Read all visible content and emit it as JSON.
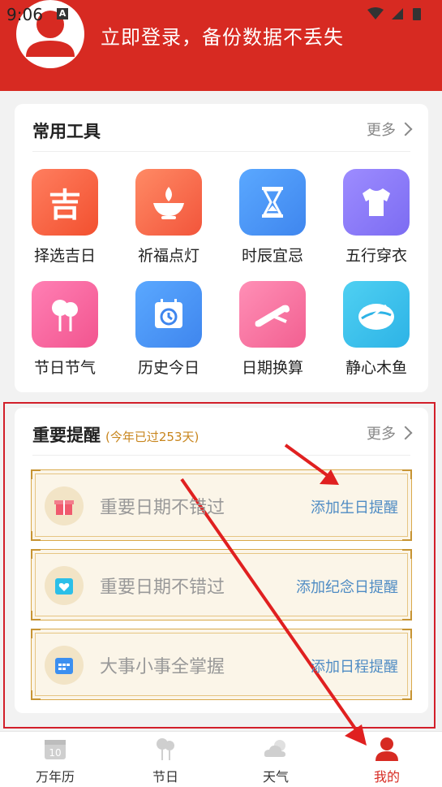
{
  "status_bar": {
    "time": "9:06",
    "indicator": "A"
  },
  "header": {
    "login_text": "立即登录，备份数据不丢失"
  },
  "tools_card": {
    "title": "常用工具",
    "more": "更多",
    "items": [
      {
        "label": "择选吉日",
        "glyph": "吉",
        "icon": "auspicious-day-icon",
        "color_from": "#ff7e5f",
        "color_to": "#f2502f"
      },
      {
        "label": "祈福点灯",
        "icon": "lamp-icon",
        "color_from": "#ff8a65",
        "color_to": "#f2553b"
      },
      {
        "label": "时辰宜忌",
        "icon": "hourglass-icon",
        "color_from": "#5aa8ff",
        "color_to": "#3f86ee"
      },
      {
        "label": "五行穿衣",
        "icon": "shirt-icon",
        "color_from": "#9d8cff",
        "color_to": "#7c6cf2"
      },
      {
        "label": "节日节气",
        "icon": "balloon-icon",
        "color_from": "#ff7fb4",
        "color_to": "#f2558f"
      },
      {
        "label": "历史今日",
        "icon": "calendar-history-icon",
        "color_from": "#5aa8ff",
        "color_to": "#3f86ee"
      },
      {
        "label": "日期换算",
        "icon": "scroll-icon",
        "color_from": "#ff8fb6",
        "color_to": "#f26091"
      },
      {
        "label": "静心木鱼",
        "icon": "wooden-fish-icon",
        "color_from": "#4fd0f2",
        "color_to": "#2db3e6"
      }
    ]
  },
  "reminder_card": {
    "title": "重要提醒",
    "subtitle": "(今年已过253天)",
    "more": "更多",
    "items": [
      {
        "text": "重要日期不错过",
        "action": "添加生日提醒",
        "icon": "gift-icon"
      },
      {
        "text": "重要日期不错过",
        "action": "添加纪念日提醒",
        "icon": "heart-calendar-icon"
      },
      {
        "text": "大事小事全掌握",
        "action": "添加日程提醒",
        "icon": "schedule-calendar-icon"
      }
    ]
  },
  "calendar_day": "10",
  "bottom_nav": [
    {
      "label": "万年历",
      "icon": "calendar-icon",
      "active": false
    },
    {
      "label": "节日",
      "icon": "festival-icon",
      "active": false
    },
    {
      "label": "天气",
      "icon": "weather-icon",
      "active": false
    },
    {
      "label": "我的",
      "icon": "profile-icon",
      "active": true
    }
  ],
  "colors": {
    "brand_red": "#d72a22",
    "action_blue": "#4f8cc4",
    "gold_border": "#d9a94a"
  }
}
